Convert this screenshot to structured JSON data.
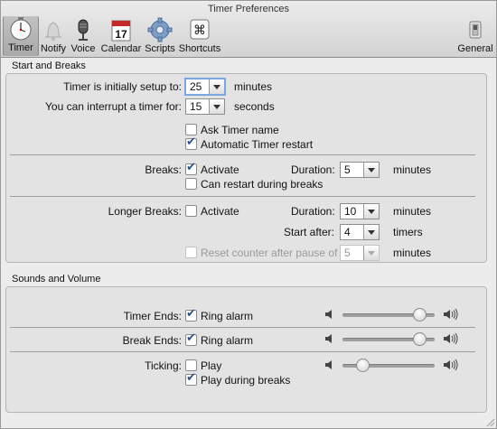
{
  "window": {
    "title": "Timer Preferences"
  },
  "toolbar": {
    "timer": "Timer",
    "notify": "Notify",
    "voice": "Voice",
    "calendar": "Calendar",
    "calendar_day": "17",
    "scripts": "Scripts",
    "shortcuts": "Shortcuts",
    "general": "General"
  },
  "start_breaks": {
    "title": "Start and Breaks",
    "setup_label": "Timer is initially setup to:",
    "setup_value": "25",
    "setup_unit": "minutes",
    "interrupt_label": "You can interrupt a timer for:",
    "interrupt_value": "15",
    "interrupt_unit": "seconds",
    "ask_name": {
      "label": "Ask Timer name",
      "checked": false
    },
    "auto_restart": {
      "label": "Automatic Timer restart",
      "checked": true
    },
    "breaks_label": "Breaks:",
    "breaks_activate": {
      "label": "Activate",
      "checked": true
    },
    "breaks_duration_label": "Duration:",
    "breaks_duration_value": "5",
    "breaks_duration_unit": "minutes",
    "can_restart": {
      "label": "Can restart during breaks",
      "checked": false
    },
    "longer_label": "Longer Breaks:",
    "longer_activate": {
      "label": "Activate",
      "checked": false
    },
    "longer_duration_label": "Duration:",
    "longer_duration_value": "10",
    "longer_duration_unit": "minutes",
    "start_after_label": "Start after:",
    "start_after_value": "4",
    "start_after_unit": "timers",
    "reset_counter": {
      "label": "Reset counter after pause of",
      "checked": false
    },
    "reset_value": "5",
    "reset_unit": "minutes"
  },
  "sounds": {
    "title": "Sounds and Volume",
    "timer_ends_label": "Timer Ends:",
    "timer_ends_ring": {
      "label": "Ring alarm",
      "checked": true
    },
    "timer_ends_volume": 0.83,
    "break_ends_label": "Break Ends:",
    "break_ends_ring": {
      "label": "Ring alarm",
      "checked": true
    },
    "break_ends_volume": 0.83,
    "ticking_label": "Ticking:",
    "ticking_play": {
      "label": "Play",
      "checked": false
    },
    "ticking_volume": 0.22,
    "play_during_breaks": {
      "label": "Play during breaks",
      "checked": true
    }
  }
}
